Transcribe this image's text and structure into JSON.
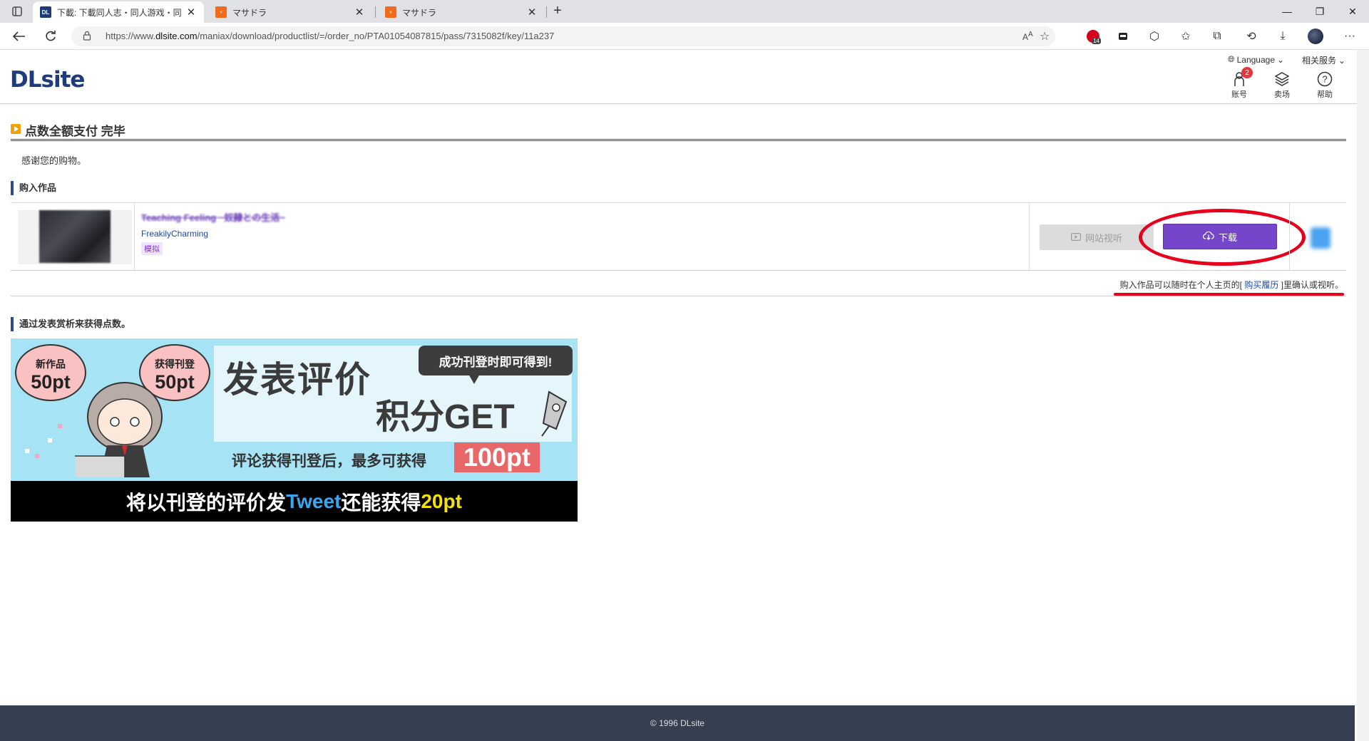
{
  "browser": {
    "tabs": [
      {
        "title": "下載: 下載同人志・同人游戏・同",
        "favicon": "DL",
        "active": true
      },
      {
        "title": "マサドラ",
        "favicon": "M",
        "active": false
      },
      {
        "title": "マサドラ",
        "favicon": "M",
        "active": false
      }
    ],
    "url_prefix": "https://www.",
    "url_domain": "dlsite.com",
    "url_path": "/maniax/download/productlist/=/order_no/PTA01054087815/pass/7315082f/key/11a237",
    "ext_badge": "14"
  },
  "header": {
    "logo": "DLsite",
    "language": "Language",
    "related": "相关服务",
    "nav": [
      {
        "label": "账号",
        "icon": "account-icon",
        "badge": "2"
      },
      {
        "label": "卖场",
        "icon": "layers-icon"
      },
      {
        "label": "帮助",
        "icon": "help-icon"
      }
    ]
  },
  "main": {
    "title": "点数全额支付 完毕",
    "thanks": "感谢您的购物。",
    "purchased_heading": "购入作品",
    "work": {
      "title": "Teaching Feeling ~奴隷との生活~",
      "maker": "FreakilyCharming",
      "tag": "模拟",
      "sample_label": "网站视听",
      "download_label": "下载"
    },
    "note_prefix": "购入作品可以随时在个人主页的[ ",
    "note_link": "购买履历",
    "note_suffix": " ]里确认或视听。",
    "review_heading": "通过发表赏析来获得点数。"
  },
  "banner": {
    "bubble1_top": "新作品",
    "bubble1_pts": "50pt",
    "bubble2_top": "获得刊登",
    "bubble2_pts": "50pt",
    "headline1": "发表评价",
    "headline2": "积分GET",
    "speech": "成功刊登时即可得到!",
    "sub_line": "评论获得刊登后，最多可获得",
    "pt100": "100pt",
    "bottom_pre": "将以刊登的评价发",
    "bottom_tweet": "Tweet",
    "bottom_mid": "还能获得",
    "bottom_pts": "20pt"
  },
  "footer": {
    "copyright": "© 1996 DLsite"
  },
  "colors": {
    "accent": "#7546c9",
    "brand": "#1e3b7a",
    "annotation": "#e6001c"
  }
}
